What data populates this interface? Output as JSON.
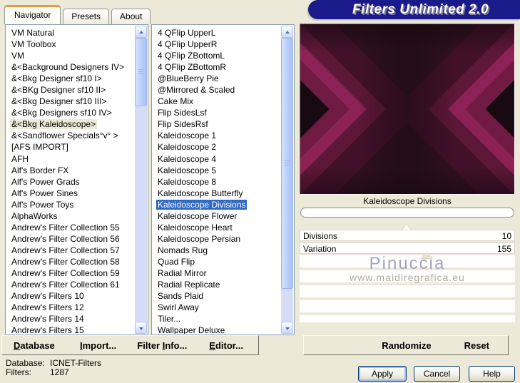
{
  "window": {
    "title": "Filters Unlimited 2.0"
  },
  "tabs": [
    {
      "label": "Navigator"
    },
    {
      "label": "Presets"
    },
    {
      "label": "About"
    }
  ],
  "category_list": {
    "selected_index": 8,
    "items": [
      "VM Natural",
      "VM Toolbox",
      "VM",
      "&<Background Designers IV>",
      "&<Bkg Designer sf10 I>",
      "&<BKg Designer sf10 II>",
      "&<Bkg Designer sf10 III>",
      "&<Bkg Designers sf10 IV>",
      "&<Bkg Kaleidoscope>",
      "&<Sandflower Specials°v° >",
      "[AFS IMPORT]",
      "AFH",
      "Alf's Border FX",
      "Alf's Power Grads",
      "Alf's Power Sines",
      "Alf's Power Toys",
      "AlphaWorks",
      "Andrew's Filter Collection 55",
      "Andrew's Filter Collection 56",
      "Andrew's Filter Collection 57",
      "Andrew's Filter Collection 58",
      "Andrew's Filter Collection 59",
      "Andrew's Filter Collection 61",
      "Andrew's Filters 10",
      "Andrew's Filters 12",
      "Andrew's Filters 14",
      "Andrew's Filters 15"
    ]
  },
  "filter_list": {
    "selected_index": 15,
    "items": [
      "4 QFlip UpperL",
      "4 QFlip UpperR",
      "4 QFlip ZBottomL",
      "4 QFlip ZBottomR",
      "@BlueBerry Pie",
      "@Mirrored & Scaled",
      "Cake Mix",
      "Flip SidesLsf",
      "Flip SidesRsf",
      "Kaleidoscope 1",
      "Kaleidoscope 2",
      "Kaleidoscope 4",
      "Kaleidoscope 5",
      "Kaleidoscope 8",
      "Kaleidoscope Butterfly",
      "Kaleidoscope Divisions",
      "Kaleidoscope Flower",
      "Kaleidoscope Heart",
      "Kaleidoscope Persian",
      "Nomads Rug",
      "Quad Flip",
      "Radial Mirror",
      "Radial Replicate",
      "Sands Plaid",
      "Swirl Away",
      "Tiler...",
      "Wallpaper Deluxe"
    ]
  },
  "preview": {
    "caption": "Kaleidoscope Divisions"
  },
  "parameters": [
    {
      "label": "Divisions",
      "value": "10"
    },
    {
      "label": "Variation",
      "value": "155"
    }
  ],
  "watermark": {
    "line1": "Pinuccia",
    "line2": "www.maidiregrafica.eu"
  },
  "toolbar": {
    "database": "Database",
    "database_key": "D",
    "import": "Import...",
    "import_key": "I",
    "filter_info": "Filter Info...",
    "filter_info_key": "I",
    "editor": "Editor...",
    "editor_key": "E",
    "randomize": "Randomize",
    "reset": "Reset"
  },
  "status": {
    "database_label": "Database:",
    "database_value": "ICNET-Filters",
    "filters_label": "Filters:",
    "filters_value": "1287"
  },
  "actions": {
    "apply": "Apply",
    "cancel": "Cancel",
    "help": "Help"
  },
  "colors": {
    "selection_blue": "#316ac5",
    "banner_navy": "#1a1a8a",
    "dialog_face": "#ece9d8",
    "preview_magenta": "#8c2255",
    "preview_dark": "#200d16"
  }
}
